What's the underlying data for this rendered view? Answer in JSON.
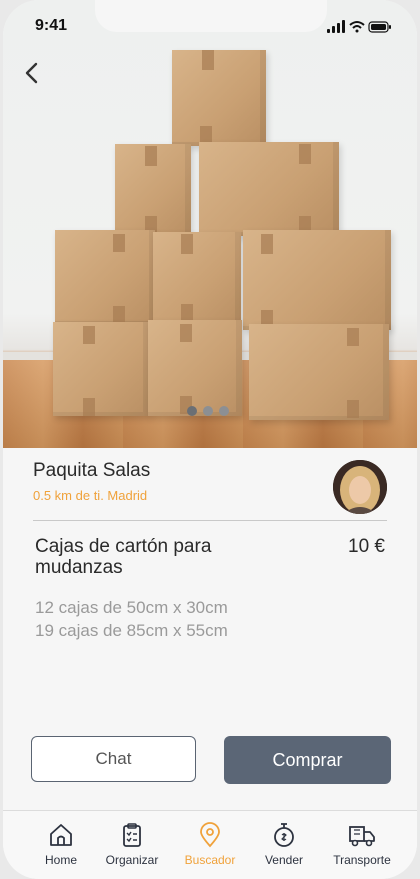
{
  "status_bar": {
    "time": "9:41"
  },
  "carousel": {
    "total_dots": 3,
    "active_index": 0
  },
  "seller": {
    "name": "Paquita Salas",
    "location": "0.5 km de ti. Madrid"
  },
  "product": {
    "title": "Cajas de cartón para mudanzas",
    "price": "10 €",
    "details": [
      "12 cajas de 50cm x 30cm",
      "19 cajas de 85cm x 55cm"
    ]
  },
  "actions": {
    "chat_label": "Chat",
    "buy_label": "Comprar"
  },
  "tabbar": {
    "items": [
      {
        "label": "Home",
        "icon": "home-icon"
      },
      {
        "label": "Organizar",
        "icon": "clipboard-icon"
      },
      {
        "label": "Buscador",
        "icon": "location-pin-icon",
        "active": true
      },
      {
        "label": "Vender",
        "icon": "coin-timer-icon"
      },
      {
        "label": "Transporte",
        "icon": "truck-icon"
      }
    ]
  },
  "colors": {
    "accent": "#f0a23b",
    "primary_button": "#5b6676",
    "text": "#2a2a2a",
    "muted": "#9a9a9a"
  }
}
